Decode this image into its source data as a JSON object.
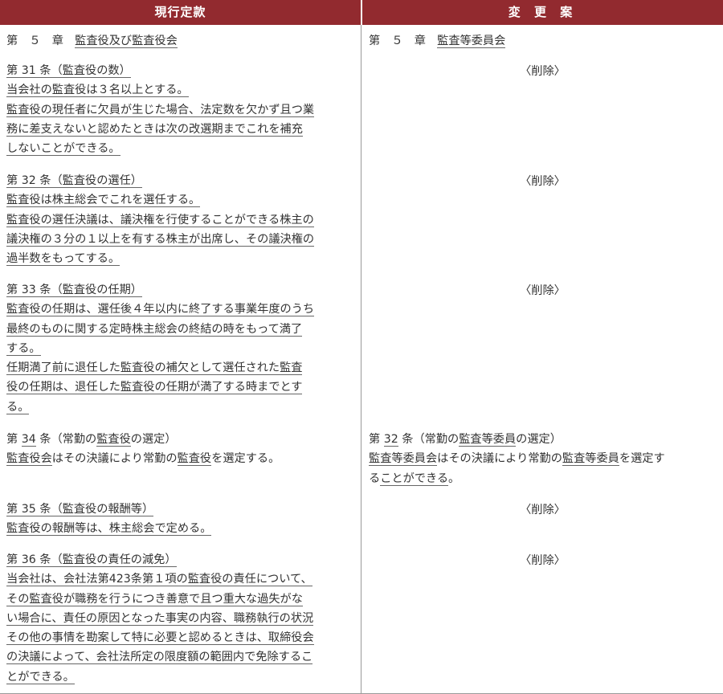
{
  "header": {
    "current": "現行定款",
    "proposal": "変 更 案"
  },
  "chapter": {
    "left": {
      "prefix": "第　５　章　",
      "title": "監査役及び監査役会"
    },
    "right": {
      "prefix": "第　５　章　",
      "title": "監査等委員会"
    }
  },
  "deleted_label": "〈削除〉",
  "articles_left": {
    "a31": [
      "第 31 条（監査役の数）",
      "当会社の監査役は３名以上とする。",
      "監査役の現任者に欠員が生じた場合、法定数を欠かず且つ業",
      "務に差支えないと認めたときは次の改選期までこれを補充",
      "しないことができる。"
    ],
    "a32": [
      "第 32 条（監査役の選任）",
      "監査役は株主総会でこれを選任する。",
      "監査役の選任決議は、議決権を行使することができる株主の",
      "議決権の３分の１以上を有する株主が出席し、その議決権の",
      "過半数をもってする。"
    ],
    "a33": [
      "第 33 条（監査役の任期）",
      "監査役の任期は、選任後４年以内に終了する事業年度のうち",
      "最終のものに関する定時株主総会の終結の時をもって満了",
      "する。",
      "任期満了前に退任した監査役の補欠として選任された監査",
      "役の任期は、退任した監査役の任期が満了する時までとす",
      "る。"
    ],
    "a34": {
      "title": {
        "p1": "第 ",
        "num": "34",
        "p2": " 条（常勤の",
        "u": "監査役",
        "p3": "の選定）"
      },
      "body": {
        "u1": "監査役会",
        "t1": "はその決議により常勤の",
        "u2": "監査役",
        "t2": "を選定する。"
      }
    },
    "a35": [
      "第 35 条（監査役の報酬等）",
      "監査役の報酬等は、株主総会で定める。"
    ],
    "a36": [
      "第 36 条（監査役の責任の減免）",
      "当会社は、会社法第423条第１項の監査役の責任について、",
      "その監査役が職務を行うにつき善意で且つ重大な過失がな",
      "い場合に、責任の原因となった事実の内容、職務執行の状況",
      "その他の事情を勘案して特に必要と認めるときは、取締役会",
      "の決議によって、会社法所定の限度額の範囲内で免除するこ",
      "とができる。"
    ]
  },
  "article_right_32": {
    "title": {
      "p1": "第 ",
      "num": "32",
      "p2": " 条（常勤の",
      "u": "監査等委員",
      "p3": "の選定）"
    },
    "line2": {
      "u1": "監査等委員会",
      "t1": "はその決議により常勤の",
      "u2": "監査等委員",
      "t2": "を選定す"
    },
    "line3": {
      "t1": "る",
      "u1": "ことができる",
      "t2": "。"
    }
  }
}
